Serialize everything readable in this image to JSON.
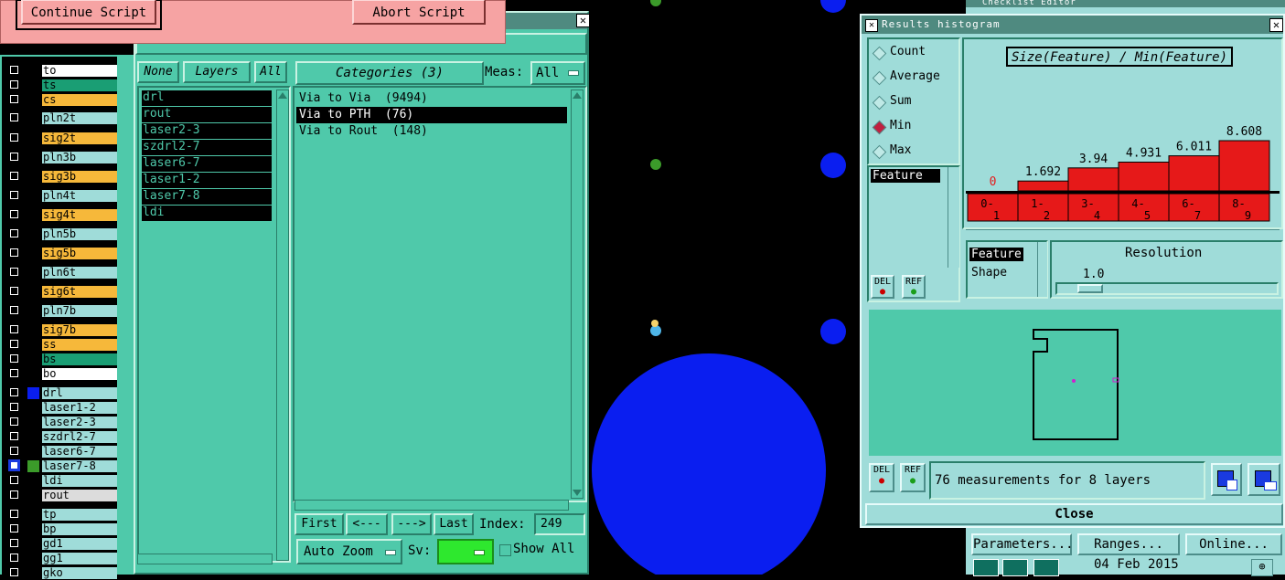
{
  "colors": {
    "teal": "#4fc9aa",
    "light_teal": "#9fdcd9",
    "pink": "#f6a3a3",
    "bar_red": "#e61919",
    "via_blue": "#0a1ef0",
    "layer_green": "#1a9e74",
    "layer_orange": "#f6b83a"
  },
  "script_prompt": {
    "continue_label": "Continue Script",
    "abort_label": "Abort Script"
  },
  "layers_panel": {
    "rows": [
      {
        "name": "to",
        "color": "#ffffff",
        "swatch": "#000000"
      },
      {
        "name": "ts",
        "color": "#1a9e74",
        "swatch": "#000000"
      },
      {
        "name": "cs",
        "color": "#f6b83a",
        "swatch": "#000000"
      },
      {
        "name": "pln2t",
        "color": "#9fdcd9",
        "swatch": "#000000"
      },
      {
        "name": "sig2t",
        "color": "#f6b83a",
        "swatch": "#000000"
      },
      {
        "name": "pln3b",
        "color": "#9fdcd9",
        "swatch": "#000000"
      },
      {
        "name": "sig3b",
        "color": "#f6b83a",
        "swatch": "#000000"
      },
      {
        "name": "pln4t",
        "color": "#9fdcd9",
        "swatch": "#000000"
      },
      {
        "name": "sig4t",
        "color": "#f6b83a",
        "swatch": "#000000"
      },
      {
        "name": "pln5b",
        "color": "#9fdcd9",
        "swatch": "#000000"
      },
      {
        "name": "sig5b",
        "color": "#f6b83a",
        "swatch": "#000000"
      },
      {
        "name": "pln6t",
        "color": "#9fdcd9",
        "swatch": "#000000"
      },
      {
        "name": "sig6t",
        "color": "#f6b83a",
        "swatch": "#000000"
      },
      {
        "name": "pln7b",
        "color": "#9fdcd9",
        "swatch": "#000000"
      },
      {
        "name": "sig7b",
        "color": "#f6b83a",
        "swatch": "#000000"
      },
      {
        "name": "ss",
        "color": "#f6b83a",
        "swatch": "#000000"
      },
      {
        "name": "bs",
        "color": "#1a9e74",
        "swatch": "#000000"
      },
      {
        "name": "bo",
        "color": "#ffffff",
        "swatch": "#000000"
      },
      {
        "name": "drl",
        "color": "#9fdcd9",
        "swatch": "#0a1ef0"
      },
      {
        "name": "laser1-2",
        "color": "#9fdcd9",
        "swatch": "#000000"
      },
      {
        "name": "laser2-3",
        "color": "#9fdcd9",
        "swatch": "#000000"
      },
      {
        "name": "szdrl2-7",
        "color": "#9fdcd9",
        "swatch": "#000000"
      },
      {
        "name": "laser6-7",
        "color": "#9fdcd9",
        "swatch": "#000000"
      },
      {
        "name": "laser7-8",
        "color": "#9fdcd9",
        "swatch": "#3b9b2a"
      },
      {
        "name": "ldi",
        "color": "#9fdcd9",
        "swatch": "#000000"
      },
      {
        "name": "rout",
        "color": "#dcdcdc",
        "swatch": "#000000"
      },
      {
        "name": "tp",
        "color": "#9fdcd9",
        "swatch": "#000000"
      },
      {
        "name": "bp",
        "color": "#9fdcd9",
        "swatch": "#000000"
      },
      {
        "name": "gd1",
        "color": "#9fdcd9",
        "swatch": "#000000"
      },
      {
        "name": "gg1",
        "color": "#9fdcd9",
        "swatch": "#000000"
      },
      {
        "name": "gko",
        "color": "#9fdcd9",
        "swatch": "#000000"
      }
    ]
  },
  "checklist_results": {
    "layer_buttons": {
      "none": "None",
      "layers": "Layers",
      "all": "All"
    },
    "layers": [
      "drl",
      "rout",
      "laser2-3",
      "szdrl2-7",
      "laser6-7",
      "laser1-2",
      "laser7-8",
      "ldi"
    ],
    "categories_label": "Categories (3)",
    "meas_label": "Meas:",
    "meas_value": "All",
    "categories": [
      "Via to Via  (9494)",
      "Via to PTH  (76)",
      "Via to Rout  (148)"
    ],
    "selected_category": 1,
    "nav": {
      "first": "First",
      "prev": "<---",
      "next": "--->",
      "last": "Last",
      "index_label": "Index:",
      "index_value": "249"
    },
    "zoom_label": "Auto Zoom",
    "sv_label": "Sv:",
    "show_all_label": "Show All"
  },
  "histogram": {
    "window_title": "Results histogram",
    "modes": [
      "Count",
      "Average",
      "Sum",
      "Min",
      "Max"
    ],
    "selected_mode": "Min",
    "chart_title": "Size(Feature) / Min(Feature)",
    "list_items": [
      "Feature"
    ],
    "del_label": "DEL",
    "ref_label": "REF",
    "resolution_items": [
      "Feature",
      "Shape"
    ],
    "resolution_label": "Resolution",
    "resolution_value": "1.0",
    "status_text": "76 measurements for 8 layers",
    "close_label": "Close"
  },
  "chart_data": {
    "type": "bar",
    "title": "Size(Feature) / Min(Feature)",
    "categories": [
      "0-1",
      "1-2",
      "3-4",
      "4-5",
      "6-7",
      "8-9"
    ],
    "values": [
      0,
      1.692,
      3.94,
      4.931,
      6.011,
      8.608
    ],
    "ylim": [
      0,
      8.608
    ],
    "grid": false
  },
  "bottom_right": {
    "parameters": "Parameters...",
    "ranges": "Ranges...",
    "online": "Online...",
    "date": "04 Feb 2015",
    "checklist_editor": "Checklist Editor"
  }
}
